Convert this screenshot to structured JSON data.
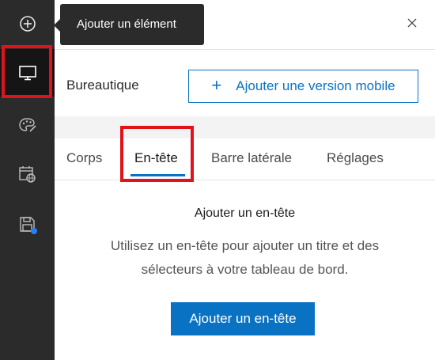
{
  "rail": {
    "items": [
      {
        "name": "add",
        "icon": "plus-circle-icon"
      },
      {
        "name": "desktop",
        "icon": "monitor-icon",
        "active": true
      },
      {
        "name": "theme",
        "icon": "palette-icon"
      },
      {
        "name": "dataset",
        "icon": "calendar-globe-icon"
      },
      {
        "name": "save",
        "icon": "save-icon",
        "badge": true
      }
    ]
  },
  "tooltip": {
    "text": "Ajouter un élément"
  },
  "panel": {
    "mode_label": "Bureautique",
    "mobile_button": {
      "plus": "+",
      "label": "Ajouter une version mobile"
    },
    "tabs": [
      {
        "label": "Corps"
      },
      {
        "label": "En-tête",
        "active": true
      },
      {
        "label": "Barre latérale"
      },
      {
        "label": "Réglages"
      }
    ],
    "empty_state": {
      "title": "Ajouter un en-tête",
      "description_line1": "Utilisez un en-tête pour ajouter un titre et des",
      "description_line2": "sélecteurs à votre tableau de bord.",
      "button": "Ajouter un en-tête"
    }
  },
  "colors": {
    "rail_bg": "#2b2b2b",
    "accent": "#0a72c2",
    "highlight": "#e0131b",
    "badge": "#2a7ff7"
  }
}
